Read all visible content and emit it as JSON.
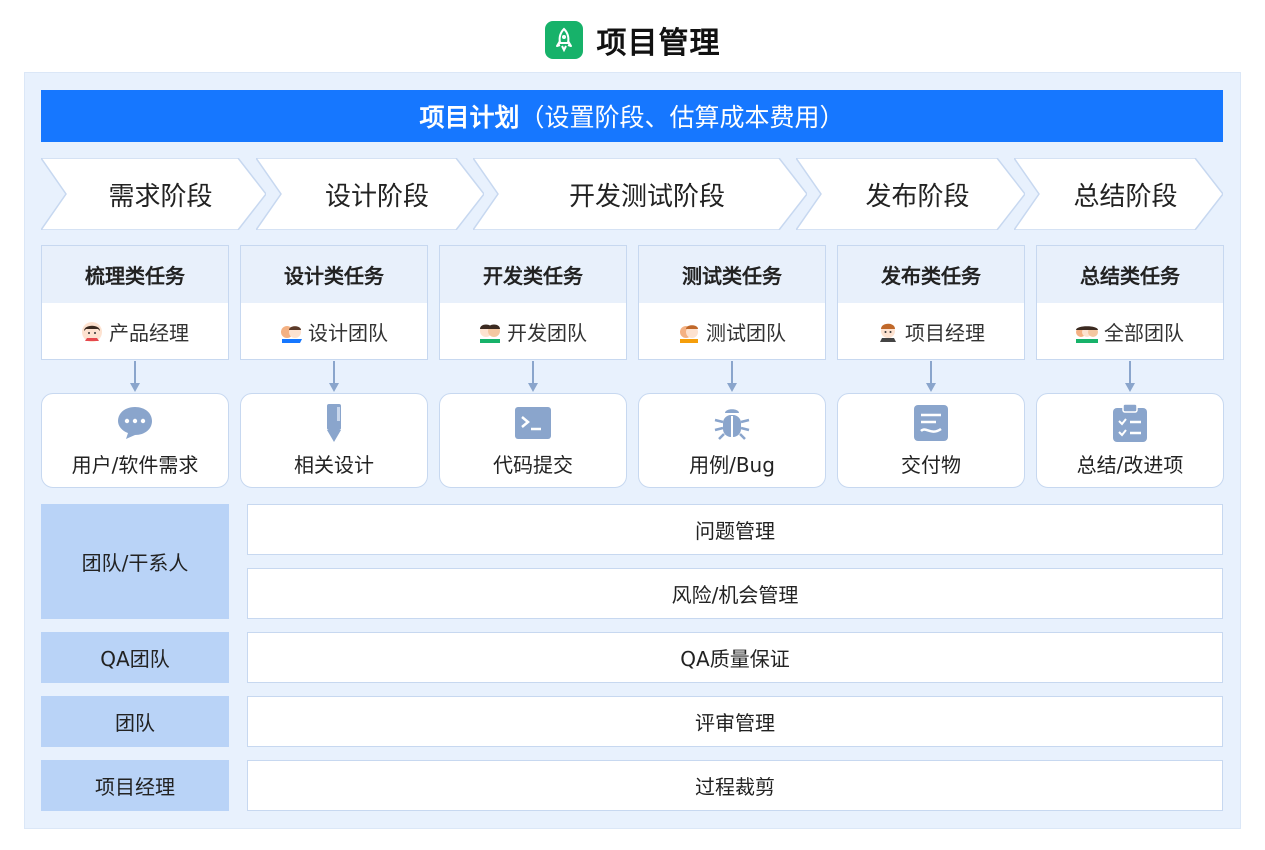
{
  "header": {
    "title": "项目管理",
    "logo_icon": "rocket-icon"
  },
  "plan": {
    "title_bold": "项目计划",
    "title_rest": "（设置阶段、估算成本费用）"
  },
  "phases": [
    {
      "label": "需求阶段"
    },
    {
      "label": "设计阶段"
    },
    {
      "label": "开发测试阶段"
    },
    {
      "label": "发布阶段"
    },
    {
      "label": "总结阶段"
    }
  ],
  "tasks": [
    {
      "title": "梳理类任务",
      "role": "产品经理",
      "output": "用户/软件需求",
      "output_icon": "chat-bubble-icon"
    },
    {
      "title": "设计类任务",
      "role": "设计团队",
      "output": "相关设计",
      "output_icon": "pen-icon"
    },
    {
      "title": "开发类任务",
      "role": "开发团队",
      "output": "代码提交",
      "output_icon": "terminal-icon"
    },
    {
      "title": "测试类任务",
      "role": "测试团队",
      "output": "用例/Bug",
      "output_icon": "bug-icon"
    },
    {
      "title": "发布类任务",
      "role": "项目经理",
      "output": "交付物",
      "output_icon": "document-icon"
    },
    {
      "title": "总结类任务",
      "role": "全部团队",
      "output": "总结/改进项",
      "output_icon": "checklist-icon"
    }
  ],
  "bottom": {
    "stakeholders": {
      "side": "团队/干系人",
      "rows": [
        "问题管理",
        "风险/机会管理"
      ]
    },
    "qa": {
      "side": "QA团队",
      "row": "QA质量保证"
    },
    "team": {
      "side": "团队",
      "row": "评审管理"
    },
    "pm": {
      "side": "项目经理",
      "row": "过程裁剪"
    }
  },
  "colors": {
    "primary": "#1677ff",
    "panel": "#e8f1fd",
    "side": "#b9d3f7",
    "logo": "#17b26a",
    "icon": "#8aa5cc"
  }
}
